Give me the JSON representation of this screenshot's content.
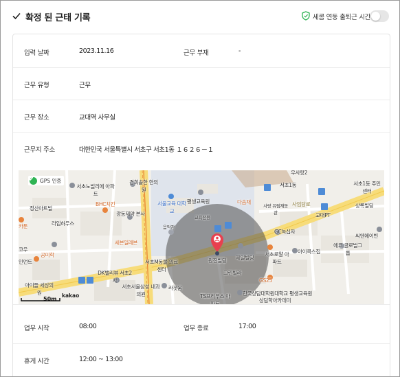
{
  "header": {
    "title": "확정 된 근태 기록",
    "toggle_label": "세콤 연동 출퇴근 시간",
    "toggle_on": false
  },
  "fields": {
    "date_label": "입력 날짜",
    "date_value": "2023.11.16",
    "absence_label": "근무 부재",
    "absence_value": "-",
    "type_label": "근무 유형",
    "type_value": "근무",
    "place_label": "근무 장소",
    "place_value": "교대역 사무실",
    "address_label": "근무지 주소",
    "address_value": "대한민국 서울특별시 서초구 서초1동 １６２６－１",
    "start_label": "업무 시작",
    "start_value": "08:00",
    "end_label": "업무 종료",
    "end_value": "17:00",
    "break_label": "휴게 시간",
    "break_value": "12:00 ~ 13:00"
  },
  "map": {
    "gps_badge": "GPS 인증",
    "scale": "50m",
    "attribution": "kakao",
    "places": [
      "우사랑2",
      "서초1동",
      "서초1동 주민센터",
      "서초노빌리에 아파트",
      "경희솔한 한의원",
      "평생교육원",
      "서울교육 대학교",
      "다솜채",
      "사랑 유림재동관",
      "사임당로",
      "상록빌딩",
      "정산아트빌",
      "BHC치킨",
      "광동제약 본사",
      "교대PT",
      "라임하우스",
      "교육전용",
      "음악관",
      "GC녹십자",
      "씨엔에이빈",
      "세븐일레븐",
      "공미학",
      "원진빌딩",
      "제일빌딩",
      "서초로얄 아파트",
      "아이콕스집",
      "에코 글로벌그룹",
      "서초M동물 의료센터",
      "DK밸리뷰 서초2차",
      "그린빌라",
      "인먼트",
      "GS25",
      "아이들 세상의원",
      "서초서울삼성 내과의원",
      "라겟움",
      "TS프리우스 아파트",
      "한국상담대학원대학교 평생교육원",
      "상담학아카데미",
      "카툰",
      "코우"
    ]
  },
  "colors": {
    "gps_green": "#2fb454",
    "shield_green": "#2fb454",
    "marker_red": "#e8404f",
    "road_yellow": "#f7dc7a"
  }
}
